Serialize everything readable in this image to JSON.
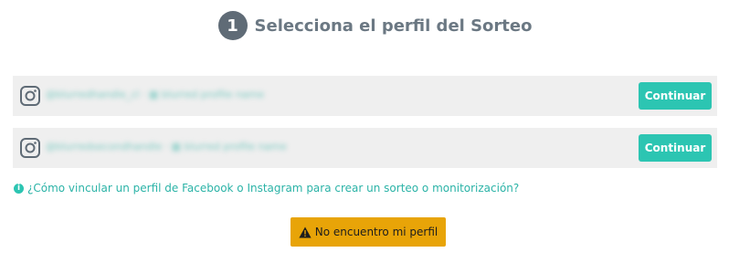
{
  "step": {
    "number": "1",
    "title": "Selecciona el perfil del Sorteo"
  },
  "profiles": [
    {
      "handle_text": "@blurredhandle_cl · ▦ blurred profile name",
      "button_label": "Continuar",
      "icon": "instagram-icon"
    },
    {
      "handle_text": "@blurredsecondhandle · ▦ blurred profile name",
      "button_label": "Continuar",
      "icon": "instagram-icon"
    }
  ],
  "help": {
    "icon": "info-icon",
    "link_text": "¿Cómo vincular un perfil de Facebook o Instagram para crear un sorteo o monitorización?"
  },
  "warning_button": {
    "icon": "warning-icon",
    "label": "No encuentro mi perfil"
  },
  "colors": {
    "accent": "#2cc5b2",
    "warning": "#e8a408",
    "row_bg": "#efefef",
    "step_circle": "#5f6b76"
  }
}
